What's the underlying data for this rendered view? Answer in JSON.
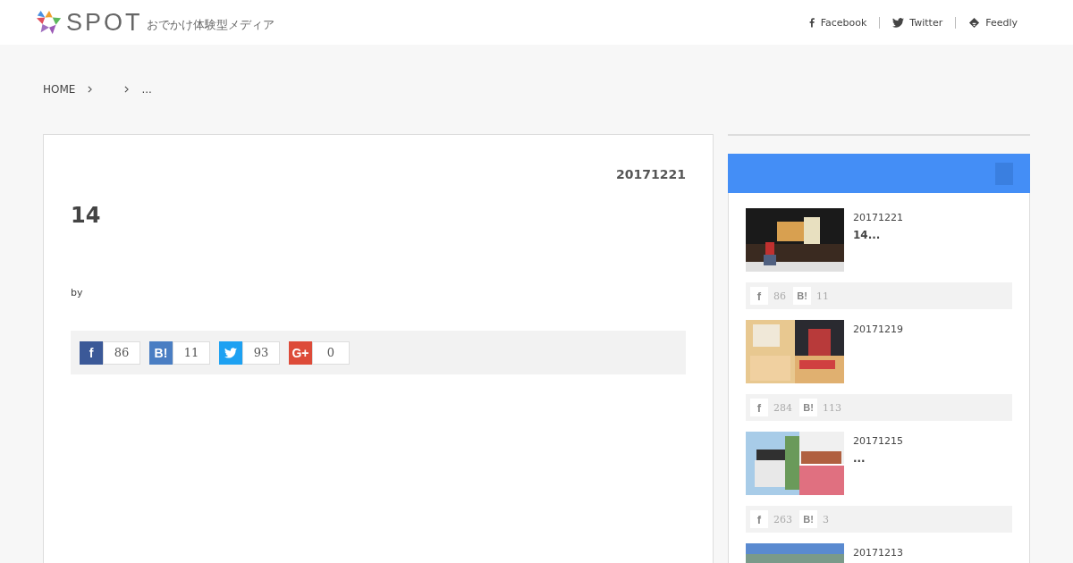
{
  "header": {
    "logo": "SPOT",
    "tagline": "おでかけ体験型メディア",
    "links": [
      {
        "kind": "facebook",
        "label": "Facebook"
      },
      {
        "kind": "twitter",
        "label": "Twitter"
      },
      {
        "kind": "feedly",
        "label": "Feedly"
      }
    ]
  },
  "breadcrumb": {
    "home": "HOME",
    "current": "..."
  },
  "article": {
    "date": "20171221",
    "title": "14",
    "byline": "by",
    "shares": [
      {
        "kind": "facebook",
        "label": "f",
        "count": "86"
      },
      {
        "kind": "hatena",
        "label": "B!",
        "count": "11"
      },
      {
        "kind": "twitter",
        "count": "93"
      },
      {
        "kind": "google",
        "label": "G+",
        "count": "0"
      }
    ]
  },
  "sidebar": {
    "posts": [
      {
        "date": "20171221",
        "title": "14...",
        "fb_mark": "f",
        "fb": "86",
        "hatena_mark": "B!",
        "hatena": "11"
      },
      {
        "date": "20171219",
        "fb_mark": "f",
        "fb": "284",
        "hatena_mark": "B!",
        "hatena": "113"
      },
      {
        "date": "20171215",
        "title": "...",
        "fb_mark": "f",
        "fb": "263",
        "hatena_mark": "B!",
        "hatena": "3"
      },
      {
        "date": "20171213"
      }
    ]
  }
}
